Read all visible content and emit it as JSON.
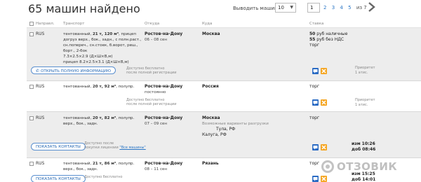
{
  "header": {
    "title": "65 машин найдено",
    "show_label": "Выводить машин",
    "show_value": "10",
    "page_current": "1",
    "pages": [
      "2",
      "3",
      "4",
      "5"
    ],
    "pages_of": "из 7"
  },
  "columns": {
    "route": "Направл.",
    "transport": "Транспорт",
    "from": "Откуда",
    "to": "Куда",
    "rate": "Ставка"
  },
  "rows": [
    {
      "country": "RUS",
      "veh_plain_1": "тентованный, ",
      "veh_bold": "21 т, 120 м³",
      "veh_plain_2": ", прицеп догруз верх., бок., задн., с полн.раст., сн.попереч., сн.стоек, б.ворот, реш., борт., 2-бок",
      "veh_dims": "7.3×2.5×2.9 (Д×Ш×В,м)",
      "veh_trailer": "прицеп 8.2×2.5×3.1 (Д×Ш×В,м)",
      "from_city": "Ростов-на-Дону",
      "from_date": "06 – 08 сен",
      "to_city": "Москва",
      "rate_line1_bold": "50",
      "rate_line1": " руб наличные",
      "rate_line2_bold": "55",
      "rate_line2": " руб без НДС",
      "rate_line3": "торг",
      "action": "ОТКРЫТЬ ПОЛНУЮ ИНФОРМАЦИЮ",
      "note_line1": "Доступно бесплатно",
      "note_line2": "после полной регистрации",
      "prio_line1": "Приоритет",
      "prio_line2": "1 атис."
    },
    {
      "country": "RUS",
      "veh_plain_1": "тентованный, ",
      "veh_bold": "20 т, 92 м³",
      "veh_plain_2": ", полупр.",
      "from_city": "Ростов-на-Дону",
      "from_date": "постоянно",
      "to_city": "Россия",
      "rate_line1": "торг",
      "note_line1": "Доступно бесплатно",
      "note_line2": "после полной регистрации",
      "prio_line1": "Приоритет",
      "prio_line2": "1 атис."
    },
    {
      "country": "RUS",
      "veh_plain_1": "тентованный, ",
      "veh_bold": "20 т, 82 м³",
      "veh_plain_2": ", полупр. верх., бок., задн.",
      "from_city": "Ростов-на-Дону",
      "from_date": "07 – 09 сен",
      "to_city": "Москва",
      "to_muted": "Возможные варианты разгрузки",
      "to_alt1": "Тула, РФ",
      "to_alt2": "Калуга, РФ",
      "rate_line1": "торг",
      "action": "ПОКАЗАТЬ КОНТАКТЫ",
      "note_line1": "Доступно после",
      "note_line2_pre": "покупки лицензии ",
      "note_link": "\"Все машины\"",
      "time1": "изм 10:26",
      "time2": "доб 08:46"
    },
    {
      "country": "RUS",
      "veh_plain_1": "тентованный, ",
      "veh_bold": "21 т, 86 м³",
      "veh_plain_2": ", полупр. верх., бок., задн.",
      "from_city": "Ростов-на-Дону",
      "from_date": "08 – 11 сен",
      "to_city": "Рязань",
      "rate_line1": "торг",
      "action": "ПОКАЗАТЬ КОНТАКТЫ",
      "note_line1": "Доступно бесплатно",
      "time1": "изм 15:25",
      "time2": "доб 14:01"
    }
  ],
  "watermark": "ОТЗОВИК",
  "colors": {
    "accent": "#2a6bc4",
    "orange": "#f5a623",
    "row_gray": "#ededed",
    "link": "#2a76c6"
  }
}
